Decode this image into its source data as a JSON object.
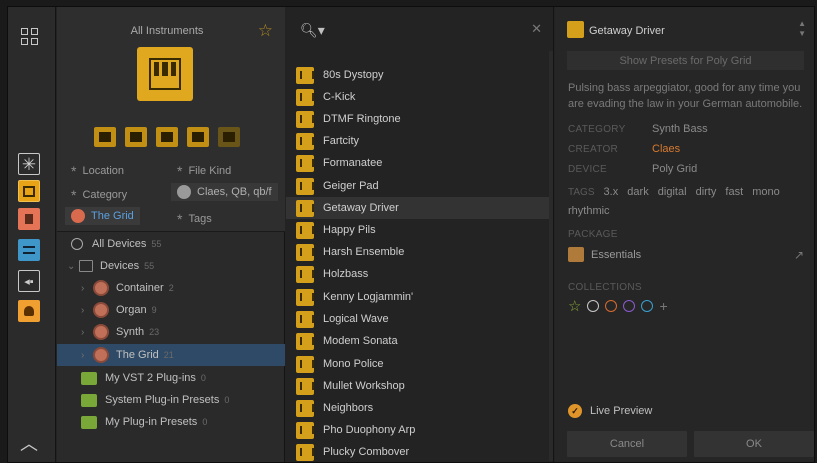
{
  "rail": {
    "items": [
      "grid-view",
      "favorites",
      "instruments",
      "audio-fx",
      "note-fx",
      "plugins",
      "user"
    ]
  },
  "filters": {
    "title": "All Instruments",
    "location_label": "Location",
    "filekind_label": "File Kind",
    "category_label": "Category",
    "creator_value": "Claes, QB, qb/f",
    "grid_value": "The Grid",
    "tags_label": "Tags"
  },
  "tree": [
    {
      "label": "All Devices",
      "count": "55"
    },
    {
      "label": "Devices",
      "count": "55"
    },
    {
      "label": "Container",
      "count": "2"
    },
    {
      "label": "Organ",
      "count": "9"
    },
    {
      "label": "Synth",
      "count": "23"
    },
    {
      "label": "The Grid",
      "count": "21"
    },
    {
      "label": "My VST 2 Plug-ins",
      "count": "0"
    },
    {
      "label": "System Plug-in Presets",
      "count": "0"
    },
    {
      "label": "My Plug-in Presets",
      "count": "0"
    }
  ],
  "results": [
    "80s Dystopy",
    "C-Kick",
    "DTMF Ringtone",
    "Fartcity",
    "Formanatee",
    "Geiger Pad",
    "Getaway Driver",
    "Happy Pils",
    "Harsh Ensemble",
    "Holzbass",
    "Kenny Logjammin'",
    "Logical Wave",
    "Modem Sonata",
    "Mono Police",
    "Mullet Workshop",
    "Neighbors",
    "Pho Duophony Arp",
    "Plucky Combover"
  ],
  "inspector": {
    "title": "Getaway Driver",
    "show_presets": "Show Presets for Poly Grid",
    "description": "Pulsing bass arpeggiator, good for any time you are evading the law in your German automobile.",
    "category_label": "CATEGORY",
    "category_value": "Synth Bass",
    "creator_label": "CREATOR",
    "creator_value": "Claes",
    "device_label": "DEVICE",
    "device_value": "Poly Grid",
    "tags_label": "TAGS",
    "tags": [
      "3.x",
      "dark",
      "digital",
      "dirty",
      "fast",
      "mono",
      "rhythmic"
    ],
    "package_label": "PACKAGE",
    "package_value": "Essentials",
    "collections_label": "COLLECTIONS",
    "collection_colors": [
      "#8aa83a",
      "#c8c8c8",
      "#d96a2e",
      "#8a5ad0",
      "#3aa0d0"
    ],
    "live_preview": "Live Preview",
    "cancel": "Cancel",
    "ok": "OK"
  }
}
